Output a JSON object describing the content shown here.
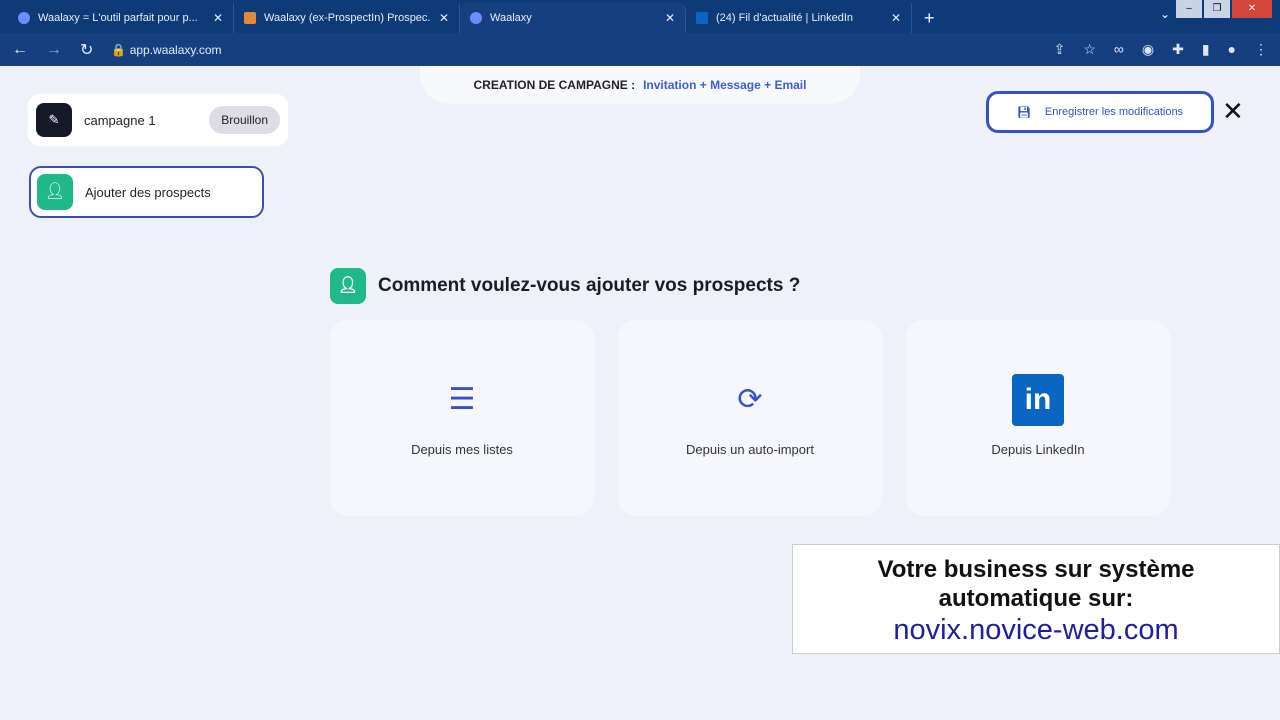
{
  "browser": {
    "tabs": [
      {
        "title": "Waalaxy = L'outil parfait pour p..."
      },
      {
        "title": "Waalaxy (ex-ProspectIn) Prospec..."
      },
      {
        "title": "Waalaxy"
      },
      {
        "title": "(24) Fil d'actualité | LinkedIn"
      }
    ],
    "url": "app.waalaxy.com"
  },
  "header": {
    "label": "CREATION DE CAMPAGNE :",
    "sequence": "Invitation + Message + Email"
  },
  "campaign": {
    "name": "campagne 1",
    "status": "Brouillon"
  },
  "sidebar": {
    "step": "Ajouter des prospects"
  },
  "save_label": "Enregistrer les modifications",
  "question": "Comment voulez-vous ajouter vos prospects ?",
  "options": [
    {
      "label": "Depuis mes listes"
    },
    {
      "label": "Depuis un auto-import"
    },
    {
      "label": "Depuis LinkedIn"
    }
  ],
  "promo": {
    "line1": "Votre business sur système",
    "line2": "automatique sur:",
    "url": "novix.novice-web.com"
  }
}
